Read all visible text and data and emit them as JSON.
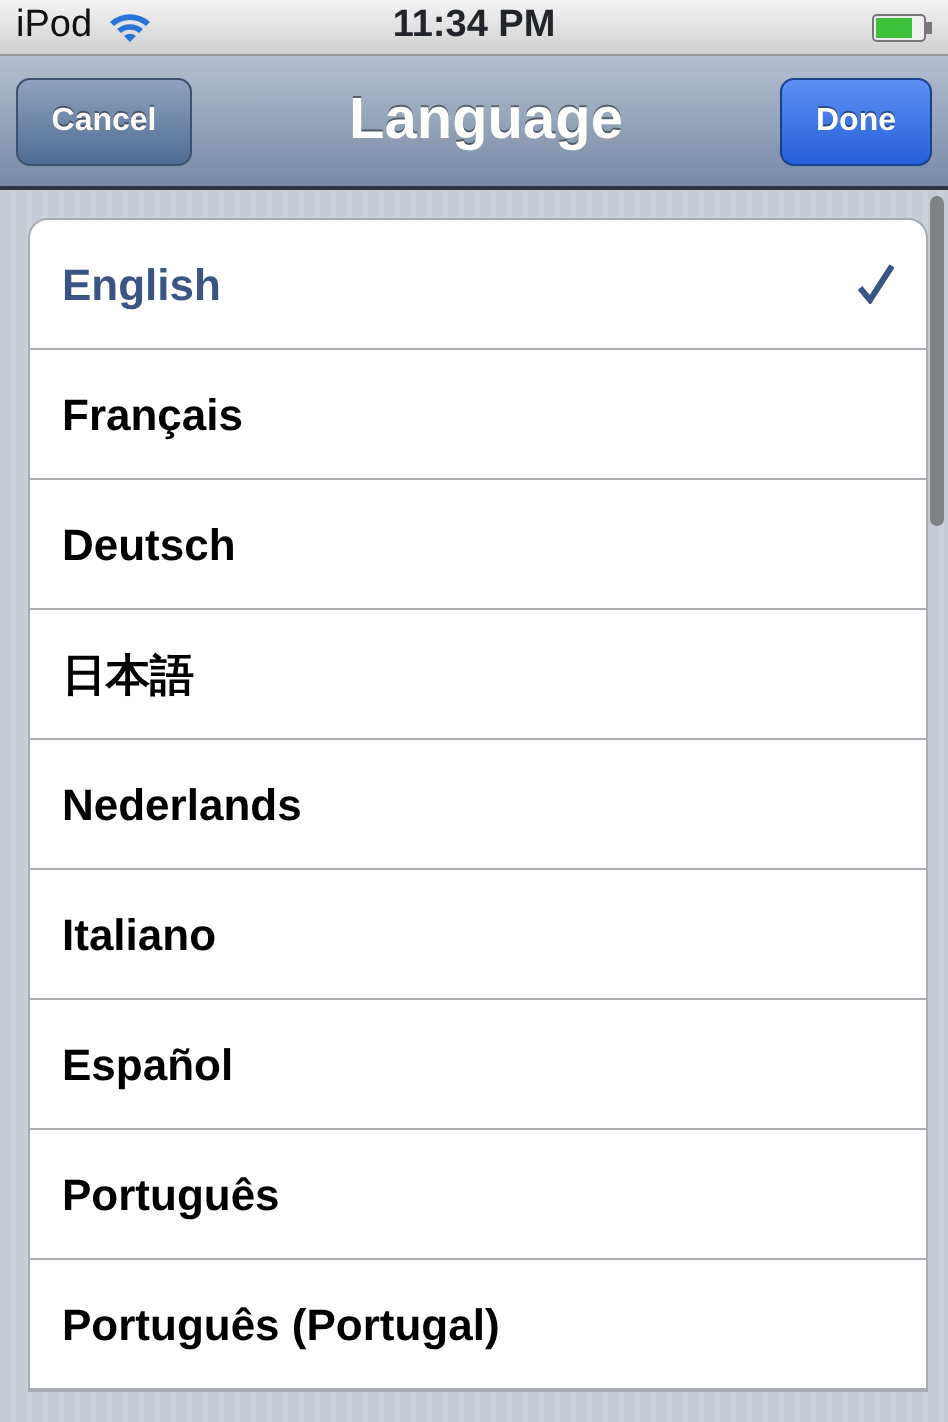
{
  "status_bar": {
    "carrier": "iPod",
    "time": "11:34 PM"
  },
  "nav_bar": {
    "title": "Language",
    "left_button": "Cancel",
    "right_button": "Done"
  },
  "languages": [
    {
      "label": "English",
      "selected": true
    },
    {
      "label": "Français",
      "selected": false
    },
    {
      "label": "Deutsch",
      "selected": false
    },
    {
      "label": "日本語",
      "selected": false
    },
    {
      "label": "Nederlands",
      "selected": false
    },
    {
      "label": "Italiano",
      "selected": false
    },
    {
      "label": "Español",
      "selected": false
    },
    {
      "label": "Português",
      "selected": false
    },
    {
      "label": "Português (Portugal)",
      "selected": false
    }
  ]
}
